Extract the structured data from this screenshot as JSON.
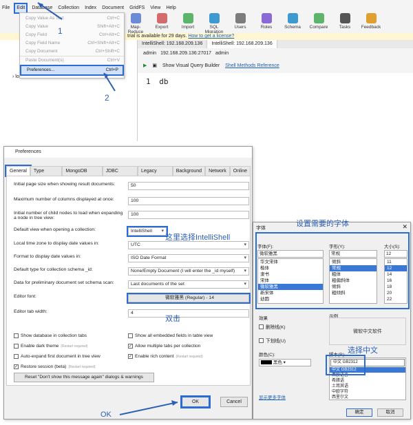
{
  "menubar": {
    "items": [
      "File",
      "Edit",
      "Database",
      "Collection",
      "Index",
      "Document",
      "GridFS",
      "View",
      "Help"
    ],
    "highlighted": "Edit"
  },
  "toolbar": [
    {
      "label": "Map-Reduce",
      "color": "#6a8bd6",
      "icon": "map-reduce-icon"
    },
    {
      "label": "Export",
      "color": "#d66a6a",
      "icon": "export-icon"
    },
    {
      "label": "Import",
      "color": "#5db56a",
      "icon": "import-icon"
    },
    {
      "label": "SQL Migration",
      "color": "#3c9ad0",
      "icon": "sql-migration-icon"
    },
    {
      "label": "Users",
      "color": "#7c7c7c",
      "icon": "users-icon"
    },
    {
      "label": "Roles",
      "color": "#8c6ad6",
      "icon": "roles-icon"
    },
    {
      "label": "Schema",
      "color": "#3c9ad0",
      "icon": "schema-icon"
    },
    {
      "label": "Compare",
      "color": "#5db56a",
      "icon": "compare-icon"
    },
    {
      "label": "Tasks",
      "color": "#555555",
      "icon": "tasks-icon"
    },
    {
      "label": "Feedback",
      "color": "#e0a030",
      "icon": "feedback-icon"
    }
  ],
  "trial": {
    "text": "trial is available for 29 days.",
    "link": "How to get a license?"
  },
  "tree": {
    "local": "local"
  },
  "tabs": [
    "IntelliShell: 192.168.209.136",
    "IntelliShell: 192.168.209.136"
  ],
  "crumbs": {
    "user": "admin",
    "host": "192.168.209.136:27017",
    "db": "admin"
  },
  "subtool": {
    "vqb": "Show Visual Query Builder",
    "link": "Shell Methods Reference"
  },
  "editor": {
    "line": "1",
    "code": "db"
  },
  "edit_menu": [
    {
      "label": "Copy Value As Text",
      "key": "Ctrl+C"
    },
    {
      "label": "Copy Value",
      "key": "Shift+Alt+C"
    },
    {
      "label": "Copy Field",
      "key": "Ctrl+Alt+C"
    },
    {
      "label": "Copy Field Name",
      "key": "Ctrl+Shift+Alt+C"
    },
    {
      "label": "Copy Document",
      "key": "Ctrl+Shift+C"
    },
    {
      "label": "Paste Document(s)",
      "key": "Ctrl+V"
    },
    {
      "label": "Preferences...",
      "key": "Ctrl+P"
    }
  ],
  "callouts": {
    "one": "1",
    "two": "2",
    "ok": "OK",
    "dbl": "双击",
    "choose_ui": "这里选择IntelliShell",
    "set_font": "设置需要的字体",
    "choose_cn": "选择中文"
  },
  "prefs": {
    "title": "Preferences",
    "tabs": [
      "General",
      "Type Colors",
      "MongoDB Tools",
      "JDBC Drivers",
      "Legacy UUID",
      "Background",
      "Network",
      "Online"
    ],
    "rows": [
      {
        "label": "Initial page size when showing result documents:",
        "value": "50"
      },
      {
        "label": "Maximum number of columns displayed at once:",
        "value": "100"
      },
      {
        "label": "Initial number of child nodes to load when expanding a node in tree view:",
        "value": "100"
      },
      {
        "label": "Default view when opening a collection:",
        "value": "IntelliShell"
      },
      {
        "label": "Local time zone to display date values in:",
        "value": "UTC"
      },
      {
        "label": "Format to display date values in:",
        "value": "ISO Date Format"
      },
      {
        "label": "Default type for collection schema _id:",
        "value": "None/Empty Document (I will enter the _id myself)"
      },
      {
        "label": "Data for preliminary document set schema scan:",
        "value": "Last documents of the set"
      },
      {
        "label": "Editor font:",
        "value": "微软雅黑 (Regular) - 14"
      },
      {
        "label": "Editor tab width:",
        "value": "4"
      }
    ],
    "checks": [
      {
        "label": "Show database in collection tabs",
        "checked": false
      },
      {
        "label": "Enable dark theme",
        "checked": false,
        "note": "(Restart required)"
      },
      {
        "label": "Auto-expand first document in tree view",
        "checked": false
      },
      {
        "label": "Restore session (beta)",
        "checked": true,
        "note": "(Restart required)"
      },
      {
        "label": "Show all embedded fields in table view",
        "checked": false
      },
      {
        "label": "Allow multiple tabs per collection",
        "checked": true
      },
      {
        "label": "Enable rich content",
        "checked": true,
        "note": "(Restart required)"
      }
    ],
    "reset": "Reset \"Don't show this message again\" dialogs & warnings",
    "ok": "OK",
    "cancel": "Cancel"
  },
  "font": {
    "title": "字体",
    "font_label": "字体(F):",
    "style_label": "字形(Y):",
    "size_label": "大小(S):",
    "font_value": "微软雅黑",
    "style_value": "常规",
    "size_value": "12",
    "fonts": [
      "华文宋体",
      "楷体",
      "隶书",
      "宋体",
      "微软雅黑",
      "新宋体",
      "幼圆"
    ],
    "styles": [
      "倾斜",
      "常规",
      "粗体",
      "粗偏斜体",
      "倾斜",
      "粗倾斜"
    ],
    "sizes": [
      "11",
      "12",
      "14",
      "16",
      "18",
      "20",
      "22"
    ],
    "effects": "效果",
    "strike": "删除线(K)",
    "underline": "下划线(U)",
    "color_label": "颜色(C):",
    "color_value": "黑色",
    "sample": "示例",
    "sample_text": "微软中文软件",
    "script_label": "脚本(R):",
    "script_value": "中文 GB2312",
    "scripts": [
      "中文 GB2312",
      "西欧语言",
      "希腊语",
      "土耳其语",
      "中欧字符",
      "西里尔文"
    ],
    "more": "显示更多字体",
    "ok": "确定",
    "cancel": "取消"
  }
}
